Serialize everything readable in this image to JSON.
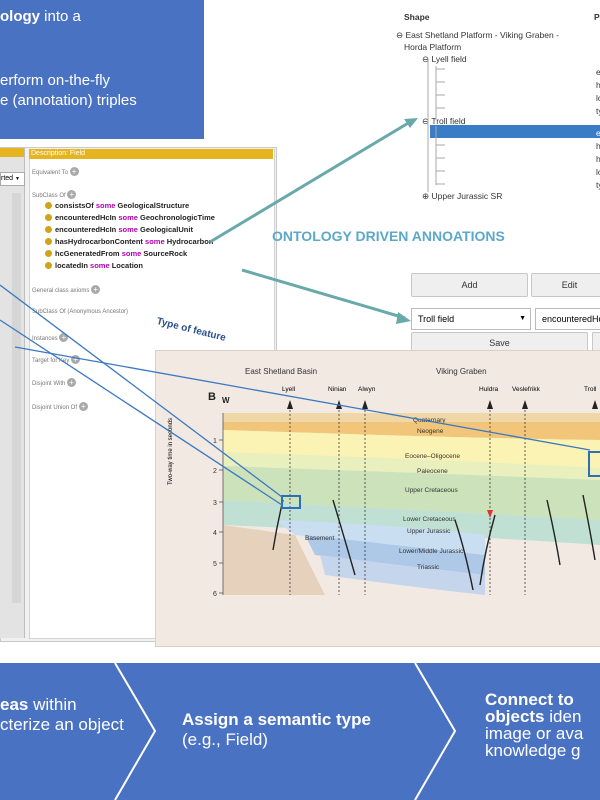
{
  "blue_box": {
    "line1_bold": "ology",
    "line1_rest": " into a",
    "line2": "erform on-the-fly",
    "line3": "e (annotation) triples"
  },
  "protege": {
    "header": "Description: Field",
    "combo_value": "rted",
    "equivalent_to": "Equivalent To",
    "subclass_of": "SubClass Of",
    "axioms": [
      {
        "prop": "consistsOf",
        "kw": "some",
        "cls": "GeologicalStructure"
      },
      {
        "prop": "encounteredHcIn",
        "kw": "some",
        "cls": "GeochronologicTime"
      },
      {
        "prop": "encounteredHcIn",
        "kw": "some",
        "cls": "GeologicalUnit"
      },
      {
        "prop": "hasHydrocarbonContent",
        "kw": "some",
        "cls": "Hydrocarbon"
      },
      {
        "prop": "hcGeneratedFrom",
        "kw": "some",
        "cls": "SourceRock"
      },
      {
        "prop": "locatedIn",
        "kw": "some",
        "cls": "Location"
      }
    ],
    "general_class_axioms": "General class axioms",
    "subclass_anonymous": "SubClass Of (Anonymous Ancestor)",
    "instances": "Instances",
    "target_for_key": "Target for Key",
    "disjoint_with": "Disjoint With",
    "disjoint_union_of": "Disjoint Union Of"
  },
  "tree": {
    "header": "Shape",
    "header_right": "P",
    "root_line1": "East Shetland Platform - Viking Graben -",
    "root_line2": "Horda Platform",
    "lyell": "Lyell field",
    "troll": "Troll field",
    "upper_jurassic": "Upper Jurassic SR",
    "right_letters_lyell": [
      "e",
      "h",
      "lo",
      "ty"
    ],
    "right_letters_troll": [
      "e",
      "h",
      "h",
      "lo",
      "ty"
    ]
  },
  "title": "ONTOLOGY DRIVEN ANNOATIONS",
  "form": {
    "add": "Add",
    "edit": "Edit",
    "select_value": "Troll field",
    "prop_value": "encounteredHc",
    "save": "Save"
  },
  "type_of_feature": "Type of feature",
  "geo": {
    "basin_left": "East Shetland Basin",
    "basin_right": "Viking Graben",
    "section_letter": "B",
    "w_letter": "W",
    "wells": [
      "Lyell",
      "Ninian",
      "Alwyn",
      "Huldra",
      "Veslefrikk",
      "Troll"
    ],
    "yaxis_label": "Two-way time in seconds",
    "ticks": [
      "1",
      "2",
      "3",
      "4",
      "5",
      "6"
    ],
    "layers": [
      "Quaternary",
      "Neogene",
      "Eocene–Oligocene",
      "Paleocene",
      "Upper Cretaceous",
      "Lower Cretaceous",
      "Upper Jurassic",
      "Lower/Middle Jurassic",
      "Triassic",
      "Basement"
    ]
  },
  "bottom": {
    "step1_bold": "eas",
    "step1_rest": " within",
    "step1_line2": "cterize an object",
    "step2_bold": "Assign a semantic type",
    "step2_line2": "(e.g., Field)",
    "step3_line1": "Connect to",
    "step3_bold2": "objects",
    "step3_rest2": " iden",
    "step3_line3": "image or ava",
    "step3_line4": "knowledge g"
  }
}
